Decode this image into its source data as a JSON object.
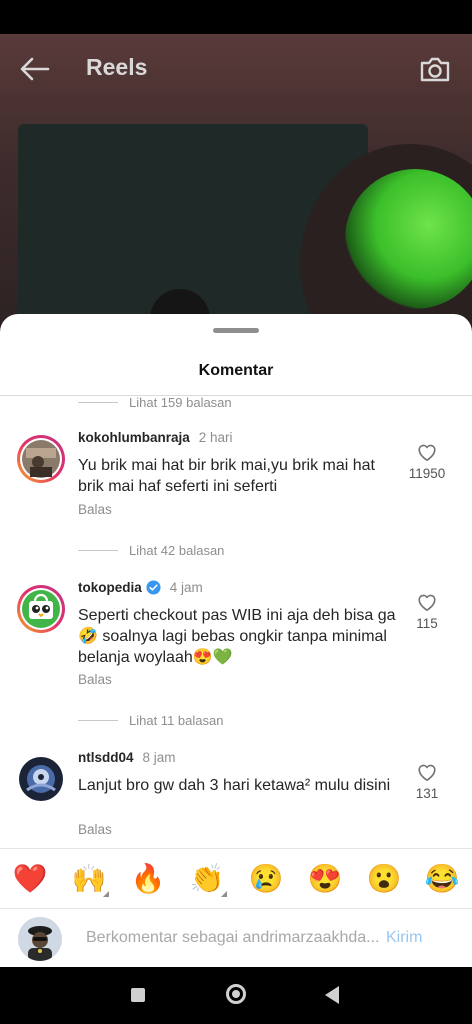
{
  "header": {
    "title": "Reels"
  },
  "sheet": {
    "title": "Komentar"
  },
  "replies": {
    "top": "Lihat 159 balasan",
    "after_first": "Lihat 42 balasan",
    "after_second": "Lihat 11 balasan"
  },
  "comments": [
    {
      "username": "kokohlumbanraja",
      "time": "2 hari",
      "text": "Yu brik mai hat bir brik mai,yu brik mai hat brik mai haf seferti ini seferti",
      "reply": "Balas",
      "likes": "11950",
      "verified": false
    },
    {
      "username": "tokopedia",
      "time": "4 jam",
      "text": "Seperti checkout pas WIB ini aja deh bisa ga 🤣 soalnya lagi bebas ongkir tanpa minimal belanja  woylaah😍💚",
      "reply": "Balas",
      "likes": "115",
      "verified": true
    },
    {
      "username": "ntlsdd04",
      "time": "8 jam",
      "text": "Lanjut bro gw dah 3 hari ketawa² mulu disini",
      "reply": "Balas",
      "likes": "131",
      "verified": false
    }
  ],
  "emoji_bar": [
    "❤️",
    "🙌",
    "🔥",
    "👏",
    "😢",
    "😍",
    "😮",
    "😂"
  ],
  "input": {
    "placeholder": "Berkomentar sebagai andrimarzaakhda...",
    "send": "Kirim"
  },
  "colors": {
    "link_blue": "#9ac7f2",
    "verified_blue": "#3897f0",
    "tokopedia_green": "#42b549"
  }
}
